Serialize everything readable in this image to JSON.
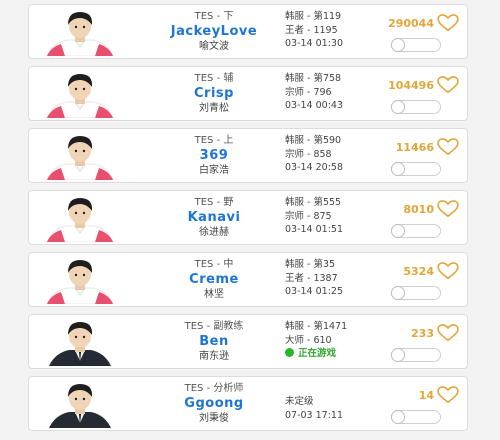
{
  "players": [
    {
      "team_role": "TES - 下",
      "nickname": "JackeyLove",
      "real_name": "喻文波",
      "rank": "韩服 - 第119",
      "tier": "王者 - 1195",
      "time": "03-14 01:30",
      "likes": "290044",
      "jersey": "pink"
    },
    {
      "team_role": "TES - 辅",
      "nickname": "Crisp",
      "real_name": "刘青松",
      "rank": "韩服 - 第758",
      "tier": "宗师 - 796",
      "time": "03-14 00:43",
      "likes": "104496",
      "jersey": "pink"
    },
    {
      "team_role": "TES - 上",
      "nickname": "369",
      "real_name": "白家浩",
      "rank": "韩服 - 第590",
      "tier": "宗师 - 858",
      "time": "03-14 20:58",
      "likes": "11466",
      "jersey": "pink"
    },
    {
      "team_role": "TES - 野",
      "nickname": "Kanavi",
      "real_name": "徐进赫",
      "rank": "韩服 - 第555",
      "tier": "宗师 - 875",
      "time": "03-14 01:51",
      "likes": "8010",
      "jersey": "pink"
    },
    {
      "team_role": "TES - 中",
      "nickname": "Creme",
      "real_name": "林坚",
      "rank": "韩服 - 第35",
      "tier": "王者 - 1387",
      "time": "03-14 01:25",
      "likes": "5324",
      "jersey": "pink"
    },
    {
      "team_role": "TES - 副教练",
      "nickname": "Ben",
      "real_name": "南东逊",
      "rank": "韩服 - 第1471",
      "tier": "大师 - 610",
      "live_status": "正在游戏",
      "likes": "233",
      "jersey": "suit"
    },
    {
      "team_role": "TES - 分析师",
      "nickname": "Ggoong",
      "real_name": "刘秉俊",
      "rank": "未定级",
      "time": "07-03 17:11",
      "likes": "14",
      "jersey": "suit"
    }
  ]
}
